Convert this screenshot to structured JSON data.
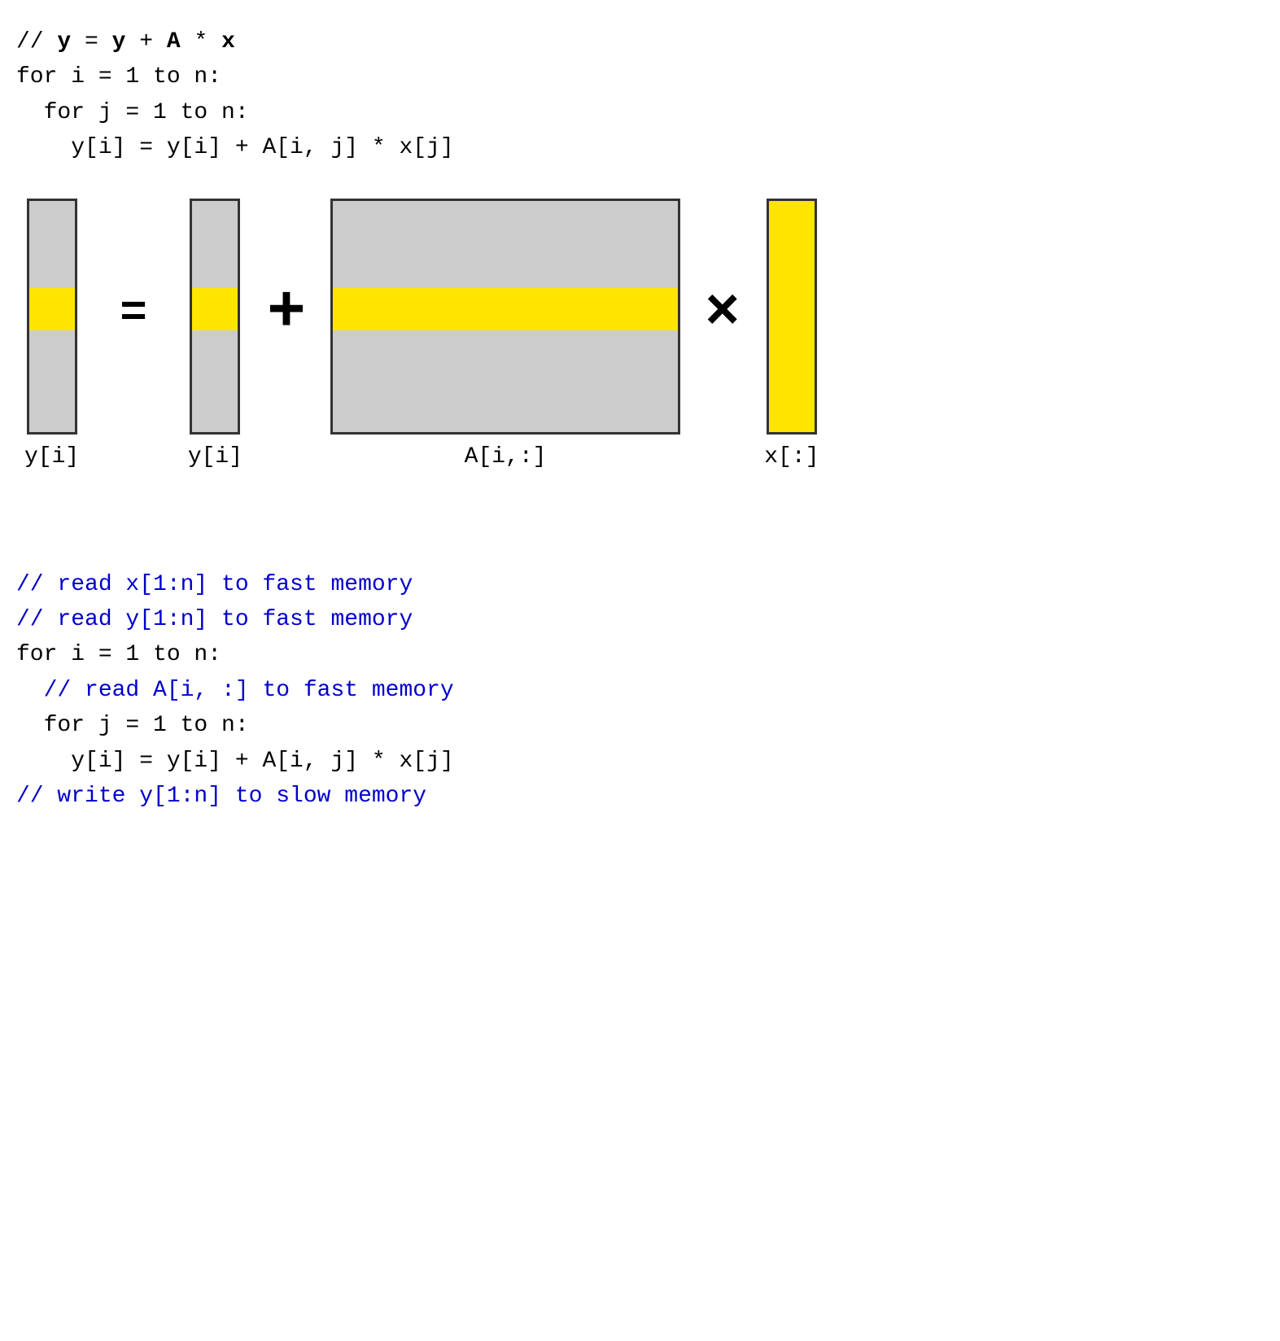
{
  "top_code": {
    "lines": [
      {
        "text": "// ",
        "bold_parts": [
          {
            "text": "y",
            "bold": true
          },
          {
            "text": " = ",
            "bold": true
          },
          {
            "text": "y",
            "bold": true
          },
          {
            "text": " + ",
            "bold": true
          },
          {
            "text": "A",
            "bold": true
          },
          {
            "text": " * ",
            "bold": true
          },
          {
            "text": "x",
            "bold": true
          }
        ],
        "raw": "// **y** = **y** + **A** * **x**",
        "display": "// y = y + A * x"
      },
      {
        "text": "for i = 1 to n:",
        "indent": 0
      },
      {
        "text": "  for j = 1 to n:",
        "indent": 1
      },
      {
        "text": "    y[i] = y[i] + A[i, j] * x[j]",
        "indent": 2
      }
    ]
  },
  "diagram": {
    "left_vec": {
      "label": "y[i]",
      "highlight_top_pct": 38,
      "highlight_height_pct": 18
    },
    "eq_symbol": "=",
    "mid_vec": {
      "label": "y[i]",
      "highlight_top_pct": 38,
      "highlight_height_pct": 18
    },
    "plus_symbol": "+",
    "matrix": {
      "label": "A[i,:]",
      "highlight_top_pct": 38,
      "highlight_height_pct": 18
    },
    "times_symbol": "×",
    "right_vec": {
      "label": "x[:]",
      "full_yellow": true
    }
  },
  "bottom_code": {
    "lines": [
      {
        "text": "// read x[1:n] to fast memory",
        "color": "blue"
      },
      {
        "text": "// read y[1:n] to fast memory",
        "color": "blue"
      },
      {
        "text": "for i = 1 to n:",
        "color": "black"
      },
      {
        "text": "  // read A[i, :] to fast memory",
        "color": "blue"
      },
      {
        "text": "  for j = 1 to n:",
        "color": "black"
      },
      {
        "text": "    y[i] = y[i] + A[i, j] * x[j]",
        "color": "black"
      },
      {
        "text": "// write y[1:n] to slow memory",
        "color": "blue"
      }
    ]
  }
}
